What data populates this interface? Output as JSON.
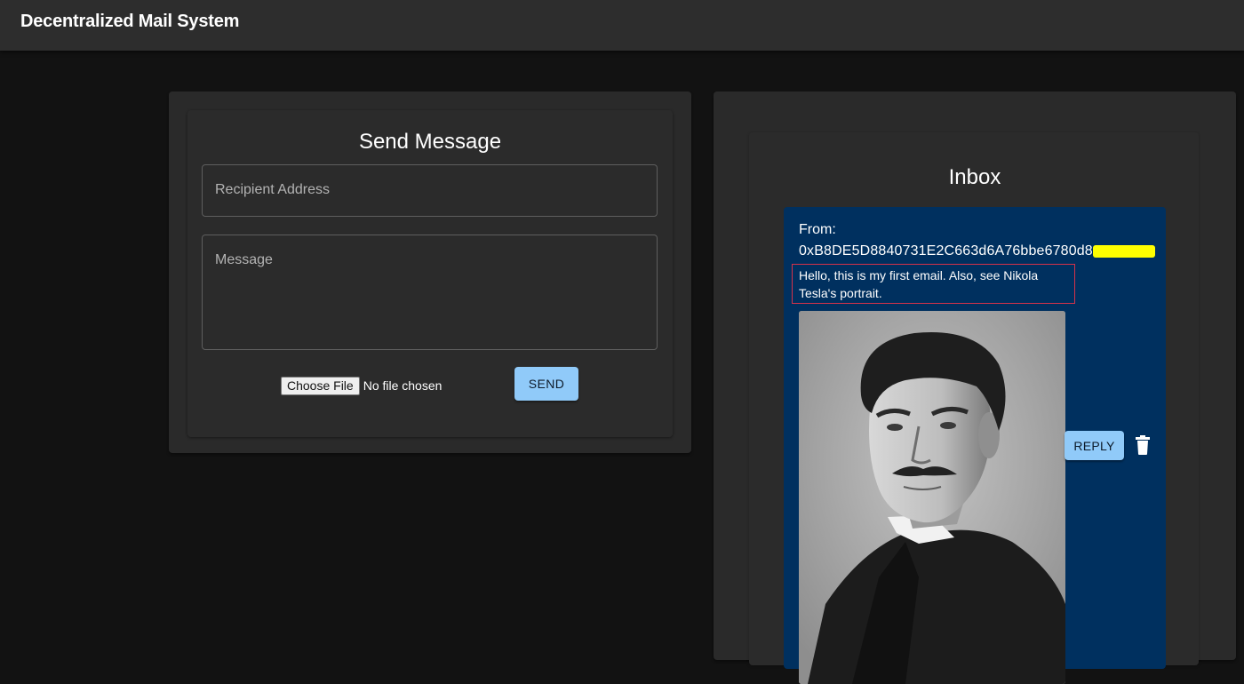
{
  "app": {
    "title": "Decentralized Mail System"
  },
  "send": {
    "title": "Send Message",
    "recipient_placeholder": "Recipient Address",
    "message_placeholder": "Message",
    "choose_file_label": "Choose File",
    "file_status": "No file chosen",
    "send_label": "SEND"
  },
  "inbox": {
    "title": "Inbox",
    "emails": [
      {
        "from_label": "From:",
        "from_address": "0xB8DE5D8840731E2C663d6A76bbe6780d8",
        "message": "Hello, this is my first email. Also, see Nikola Tesla's portrait.",
        "attachment_icon": "portrait-image",
        "reply_label": "REPLY",
        "delete_icon": "trash-icon"
      }
    ]
  },
  "colors": {
    "appbar": "#2d2d2d",
    "background": "#121212",
    "panel": "#2a2a2a",
    "mail_card": "#00305f",
    "accent_button": "#90caf9",
    "highlight_border": "#d6324a",
    "redaction": "#ffff00"
  }
}
